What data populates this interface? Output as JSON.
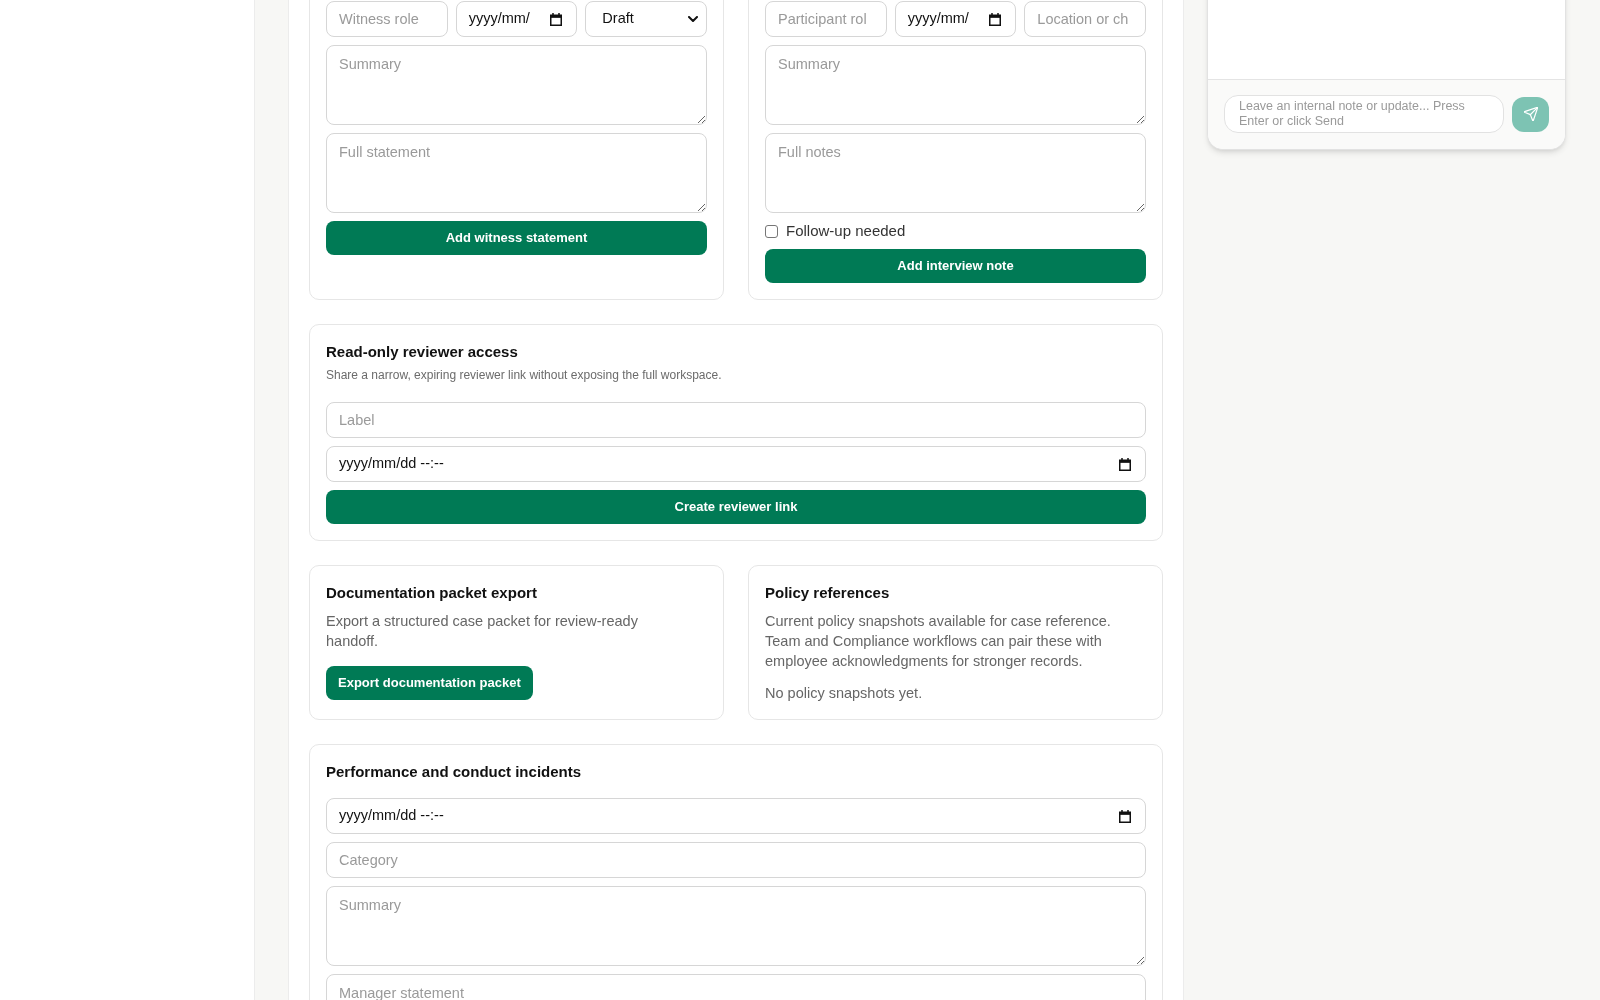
{
  "witness_statement_form": {
    "fields": [
      {
        "kind": "text",
        "placeholder": "Witness role"
      },
      {
        "kind": "date",
        "value": "yyyy/mm/"
      },
      {
        "kind": "select",
        "value": "Draft"
      }
    ],
    "text_areas": [
      {
        "placeholder": "Summary"
      },
      {
        "placeholder": "Full statement"
      }
    ],
    "button": {
      "label": "Add witness statement"
    }
  },
  "interview_note_form": {
    "fields": [
      {
        "kind": "text",
        "placeholder": "Participant rol"
      },
      {
        "kind": "date",
        "value": "yyyy/mm/"
      },
      {
        "kind": "text",
        "placeholder": "Location or ch"
      }
    ],
    "text_areas": [
      {
        "placeholder": "Summary"
      },
      {
        "placeholder": "Full notes"
      }
    ],
    "follow_up": {
      "label": "Follow-up needed",
      "checked": false
    },
    "button": {
      "label": "Add interview note"
    }
  },
  "reviewer_access": {
    "title": "Read-only reviewer access",
    "description": "Share a narrow, expiring reviewer link without exposing the full workspace.",
    "fields": [
      {
        "kind": "text",
        "placeholder": "Label"
      },
      {
        "kind": "datetime",
        "value": "yyyy/mm/dd --:--"
      }
    ],
    "button": {
      "label": "Create reviewer link"
    }
  },
  "documentation_export": {
    "title": "Documentation packet export",
    "description": "Export a structured case packet for review-ready handoff.",
    "button": {
      "label": "Export documentation packet"
    }
  },
  "policy_references": {
    "title": "Policy references",
    "description": "Current policy snapshots available for case reference. Team and Compliance workflows can pair these with employee acknowledgments for stronger records.",
    "empty_message": "No policy snapshots yet."
  },
  "incidents": {
    "title": "Performance and conduct incidents",
    "fields": [
      {
        "kind": "datetime",
        "value": "yyyy/mm/dd --:--"
      },
      {
        "kind": "text",
        "placeholder": "Category"
      },
      {
        "kind": "textarea",
        "placeholder": "Summary"
      },
      {
        "kind": "textarea",
        "placeholder": "Manager statement"
      }
    ]
  },
  "notes_panel": {
    "composer": {
      "placeholder": "Leave an internal note or update... Press Enter or click Send"
    },
    "send_button": {
      "disabled": true
    }
  }
}
